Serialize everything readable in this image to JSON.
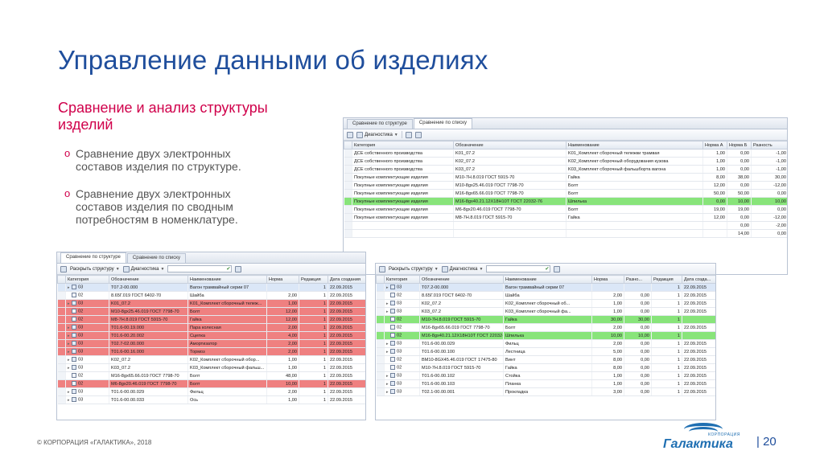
{
  "slide": {
    "title": "Управление данными об изделиях",
    "subtitle": "Сравнение и анализ структуры изделий",
    "bullet_marker": "o",
    "bullets": [
      "Сравнение двух электронных составов изделия по структуре.",
      "Сравнение двух электронных составов изделия по сводным потребностям в номенклатуре."
    ],
    "copyright": "© КОРПОРАЦИЯ «ГАЛАКТИКА», 2018",
    "page_number": "| 20",
    "logo": {
      "kicker": "КОРПОРАЦИЯ",
      "brand": "Галактика"
    }
  },
  "list_window": {
    "tabs": [
      "Сравнение по структуре",
      "Сравнение по списку"
    ],
    "toolbar": {
      "diagnostics": "Диагностика"
    },
    "headers": [
      "Категория",
      "Обозначение",
      "Наименование",
      "Норма A",
      "Норма Б",
      "Разность"
    ],
    "rows": [
      [
        "ДСЕ собственного производства",
        "K01_07.2",
        "K01_Комплект сборочный тележки трамвая",
        "1,00",
        "0,00",
        "-1,00"
      ],
      [
        "ДСЕ собственного производства",
        "K02_07.2",
        "K02_Комплект сборочный оборудования кузова",
        "1,00",
        "0,00",
        "-1,00"
      ],
      [
        "ДСЕ собственного производства",
        "K03_07.2",
        "K03_Комплект сборочный фальшборта вагона",
        "1,00",
        "0,00",
        "-1,00"
      ],
      [
        "Покупные комплектующие изделия",
        "M10-7H.8.019 ГОСТ 5915-70",
        "Гайка",
        "8,00",
        "38,00",
        "30,00"
      ],
      [
        "Покупные комплектующие изделия",
        "M10-8gx25.46.019 ГОСТ 7798-70",
        "Болт",
        "12,00",
        "0,00",
        "-12,00"
      ],
      [
        "Покупные комплектующие изделия",
        "M16-8gx65.66.019 ГОСТ 7798-70",
        "Болт",
        "50,00",
        "50,00",
        "0,00"
      ],
      [
        "Покупные комплектующие изделия",
        "M16-8gx40.21.12X18H10T ГОСТ 22032-76",
        "Шпилька",
        "0,00",
        "10,00",
        "10,00"
      ],
      [
        "Покупные комплектующие изделия",
        "M6-8gx20.46.019 ГОСТ 7798-70",
        "Болт",
        "19,00",
        "19,00",
        "0,00"
      ],
      [
        "Покупные комплектующие изделия",
        "M8-7H.8.019 ГОСТ 5915-70",
        "Гайка",
        "12,00",
        "0,00",
        "-12,00"
      ],
      [
        "",
        "",
        "",
        "",
        "0,00",
        "-2,00"
      ],
      [
        "",
        "",
        "",
        "",
        "14,00",
        "0,00"
      ]
    ]
  },
  "left_window": {
    "tabs": [
      "Сравнение по структуре",
      "Сравнение по списку"
    ],
    "toolbar": {
      "expand": "Раскрыть структуру",
      "diagnostics": "Диагностика"
    },
    "headers": [
      "Категория",
      "Обозначение",
      "Наименование",
      "Норма",
      "Редакция",
      "Дата создания"
    ],
    "rows": [
      [
        "03",
        "T07.2-00.000",
        "Вагон трамвайный серии 07",
        "",
        "1",
        "22.09.2015"
      ],
      [
        "02",
        "8.65Г.019 ГОСТ 6402-70",
        "Шайба",
        "2,00",
        "1",
        "22.09.2015"
      ],
      [
        "03",
        "K01_07.2",
        "K01_Комплект сборочный тележ...",
        "1,00",
        "1",
        "22.09.2015"
      ],
      [
        "02",
        "M10-8gx25.46.019 ГОСТ 7798-70",
        "Болт",
        "12,00",
        "1",
        "22.09.2015"
      ],
      [
        "02",
        "M8-7H.8.019 ГОСТ 5915-70",
        "Гайка",
        "12,00",
        "1",
        "22.09.2015"
      ],
      [
        "03",
        "T01.6-00.19.000",
        "Пара колесная",
        "2,00",
        "1",
        "22.09.2015"
      ],
      [
        "03",
        "T01.6-00.20.002",
        "Сцепка",
        "4,00",
        "1",
        "22.09.2015"
      ],
      [
        "03",
        "T02.7-02.00.000",
        "Амортизатор",
        "2,00",
        "1",
        "22.09.2015"
      ],
      [
        "03",
        "T01.6-00.16.000",
        "Тормоз",
        "2,00",
        "1",
        "22.09.2015"
      ],
      [
        "03",
        "K02_07.2",
        "K02_Комплект сборочный обор...",
        "1,00",
        "1",
        "22.09.2015"
      ],
      [
        "03",
        "K03_07.2",
        "K03_Комплект сборочный фальш...",
        "1,00",
        "1",
        "22.09.2015"
      ],
      [
        "02",
        "M16-8gx65.66.019 ГОСТ 7798-70",
        "Болт",
        "48,00",
        "1",
        "22.09.2015"
      ],
      [
        "02",
        "M6-8gx20.46.019 ГОСТ 7798-70",
        "Болт",
        "10,00",
        "1",
        "22.09.2015"
      ],
      [
        "03",
        "T01.6-00.00.029",
        "Фильц",
        "2,00",
        "1",
        "22.09.2015"
      ],
      [
        "03",
        "T01.6-00.00.033",
        "Ось",
        "1,00",
        "1",
        "22.09.2015"
      ]
    ],
    "row_states": [
      "sel",
      "",
      "red",
      "red",
      "red",
      "red",
      "red",
      "red",
      "red",
      "",
      "",
      "",
      "red",
      "",
      ""
    ]
  },
  "right_window": {
    "toolbar": {
      "expand": "Раскрыть структуру",
      "diagnostics": "Диагностика"
    },
    "headers": [
      "Категория",
      "Обозначение",
      "Наименование",
      "Норма",
      "Разно...",
      "Редакция",
      "Дата созда..."
    ],
    "rows": [
      [
        "03",
        "T07.2-00.000",
        "Вагон трамвайный серии 07",
        "",
        "",
        "1",
        "22.09.2015"
      ],
      [
        "02",
        "8.65Г.019 ГОСТ 6402-70",
        "Шайба",
        "2,00",
        "0,00",
        "1",
        "22.09.2015"
      ],
      [
        "03",
        "K02_07.2",
        "K02_Комплект сборочный об...",
        "1,00",
        "0,00",
        "1",
        "22.09.2015"
      ],
      [
        "03",
        "K03_07.2",
        "K03_Комплект сборочный фа...",
        "1,00",
        "0,00",
        "1",
        "22.09.2015"
      ],
      [
        "02",
        "M10-7H.8.019 ГОСТ 5915-70",
        "Гайка",
        "30,00",
        "30,00",
        "1",
        ""
      ],
      [
        "02",
        "M16-8gx65.66.019 ГОСТ 7798-70",
        "Болт",
        "2,00",
        "0,00",
        "1",
        "22.09.2015"
      ],
      [
        "02",
        "M16-8gx40.21.12X18H10T ГОСТ 22032-76",
        "Шпилька",
        "10,00",
        "10,00",
        "1",
        ""
      ],
      [
        "03",
        "T01.6-00.00.029",
        "Фильц",
        "2,00",
        "0,00",
        "1",
        "22.09.2015"
      ],
      [
        "03",
        "T01.6-00.00.100",
        "Лестница",
        "5,00",
        "0,00",
        "1",
        "22.09.2015"
      ],
      [
        "02",
        "BM10-8GX45.46.019 ГОСТ 17475-80",
        "Винт",
        "8,00",
        "0,00",
        "1",
        "22.09.2015"
      ],
      [
        "02",
        "M10-7H.8.019 ГОСТ 5915-70",
        "Гайка",
        "8,00",
        "0,00",
        "1",
        "22.09.2015"
      ],
      [
        "03",
        "T01.6-00.00.102",
        "Стойка",
        "1,00",
        "0,00",
        "1",
        "22.09.2015"
      ],
      [
        "03",
        "T01.6-00.00.103",
        "Планка",
        "1,00",
        "0,00",
        "1",
        "22.09.2015"
      ],
      [
        "03",
        "T02.1-00.00.001",
        "Прокладка",
        "3,00",
        "0,00",
        "1",
        "22.09.2015"
      ]
    ],
    "row_states": [
      "sel",
      "",
      "",
      "",
      "green",
      "",
      "green",
      "",
      "",
      "",
      "",
      "",
      "",
      ""
    ]
  }
}
